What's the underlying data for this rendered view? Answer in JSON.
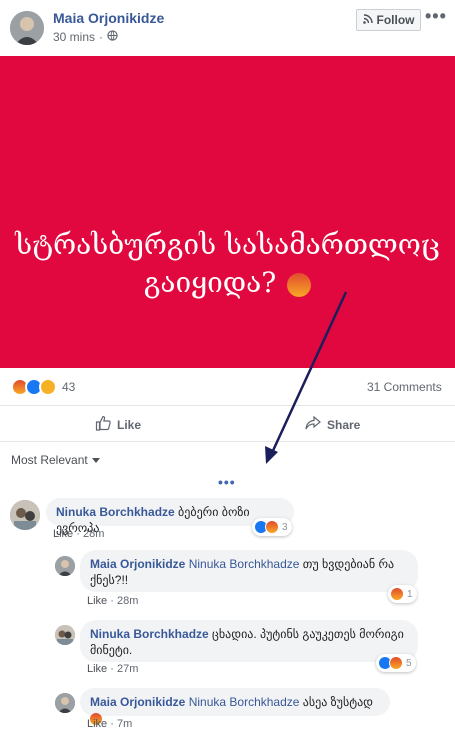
{
  "post": {
    "author": "Maia Orjonikidze",
    "time": "30 mins",
    "follow_label": "Follow",
    "more_label": "•••",
    "image_text_line1": "სტრასბურგის სასამართლოც",
    "image_text_line2": "გაიყიდა?",
    "image_bg": "#e0083e"
  },
  "reactions": {
    "count": "43",
    "comments": "31 Comments"
  },
  "actions": {
    "like": "Like",
    "share": "Share"
  },
  "sort": {
    "label": "Most Relevant"
  },
  "more_comments_label": "•••",
  "comments": [
    {
      "name": "Ninuka Borchkhadze",
      "mention": "",
      "text": "ბებერი ბოზი ევროპა",
      "like": "Like",
      "time": "28m",
      "react_count": "3"
    },
    {
      "name": "Maia Orjonikidze",
      "mention": "Ninuka Borchkhadze",
      "text": "თუ ხვდებიან რა ქნეს?!!",
      "like": "Like",
      "time": "28m",
      "react_count": "1"
    },
    {
      "name": "Ninuka Borchkhadze",
      "mention": "",
      "text": "ცხადია. პუტინს გაუკეთეს მორიგი მინეტი.",
      "like": "Like",
      "time": "27m",
      "react_count": "5"
    },
    {
      "name": "Maia Orjonikidze",
      "mention": "Ninuka Borchkhadze",
      "text": "ასეა ზუსტად",
      "like": "Like",
      "time": "7m",
      "react_count": ""
    }
  ]
}
